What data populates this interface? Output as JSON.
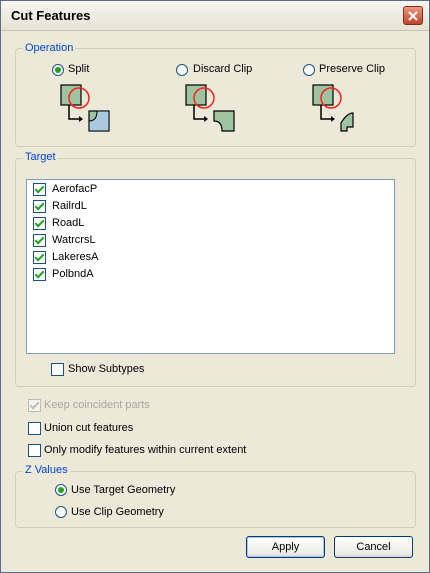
{
  "window": {
    "title": "Cut Features"
  },
  "icons": {
    "close": "close-icon",
    "split": "split-diagram-icon",
    "discard": "discard-clip-diagram-icon",
    "preserve": "preserve-clip-diagram-icon"
  },
  "operation": {
    "legend": "Operation",
    "options": [
      {
        "label": "Split",
        "checked": true
      },
      {
        "label": "Discard Clip",
        "checked": false
      },
      {
        "label": "Preserve Clip",
        "checked": false
      }
    ]
  },
  "target": {
    "legend": "Target",
    "items": [
      {
        "label": "AerofacP",
        "checked": true
      },
      {
        "label": "RailrdL",
        "checked": true
      },
      {
        "label": "RoadL",
        "checked": true
      },
      {
        "label": "WatrcrsL",
        "checked": true
      },
      {
        "label": "LakeresA",
        "checked": true
      },
      {
        "label": "PolbndA",
        "checked": true
      }
    ],
    "show_subtypes_label": "Show Subtypes",
    "show_subtypes_checked": false
  },
  "options": {
    "keep_coincident_label": "Keep coincident parts",
    "keep_coincident_checked": true,
    "keep_coincident_enabled": false,
    "union_cut_label": "Union cut features",
    "union_cut_checked": false,
    "only_modify_label": "Only modify features within current extent",
    "only_modify_checked": false
  },
  "zvalues": {
    "legend": "Z Values",
    "options": [
      {
        "label": "Use Target Geometry",
        "checked": true
      },
      {
        "label": "Use Clip Geometry",
        "checked": false
      }
    ]
  },
  "buttons": {
    "apply": "Apply",
    "cancel": "Cancel"
  },
  "colors": {
    "accent": "#0046d5",
    "check": "#21a121",
    "shape_fill": "#9fc39f",
    "clip_circle": "#ff2020"
  }
}
